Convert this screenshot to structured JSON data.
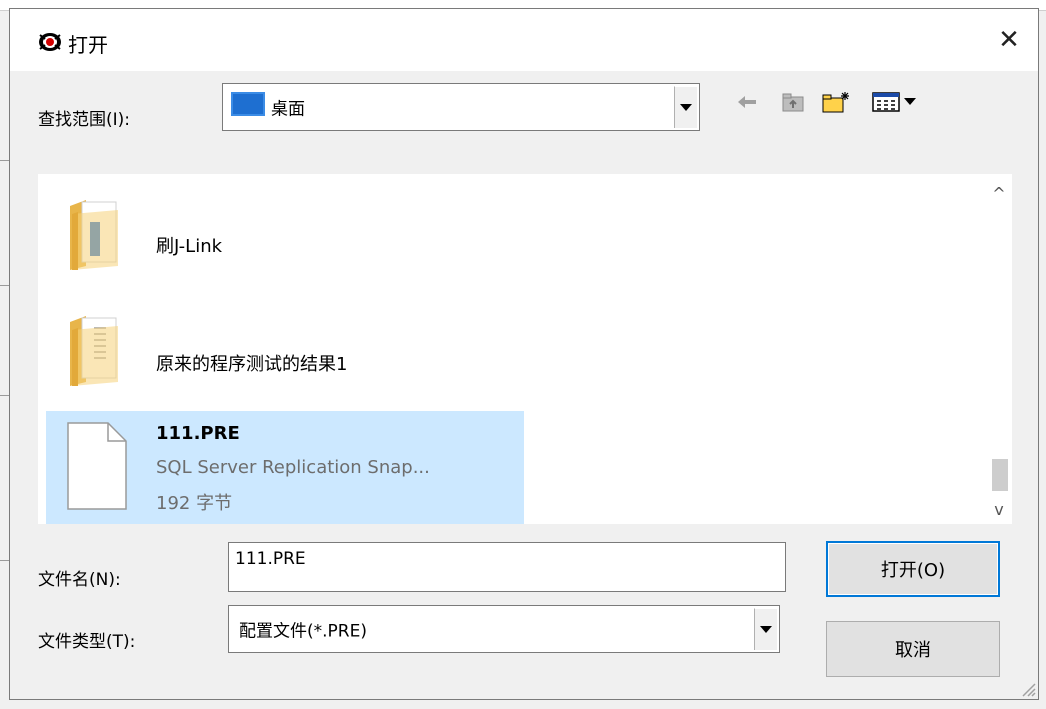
{
  "dialog": {
    "title": "打开",
    "close_symbol": "✕",
    "app_icon": "app-logo-icon"
  },
  "lookin": {
    "label": "查找范围(I):",
    "value": "桌面",
    "location_icon": "desktop-icon"
  },
  "toolbar": {
    "back_icon": "back-arrow-icon",
    "up_icon": "up-folder-icon",
    "new_folder_icon": "new-folder-icon",
    "view_icon": "view-menu-icon"
  },
  "files": [
    {
      "name": "刷J-Link",
      "type": "folder"
    },
    {
      "name": "原来的程序测试的结果1",
      "type": "folder"
    },
    {
      "name": "111.PRE",
      "description": "SQL Server Replication Snap...",
      "size": "192 字节",
      "type": "file",
      "selected": true
    }
  ],
  "scrollbar": {
    "up": "^",
    "down": "v"
  },
  "filename": {
    "label": "文件名(N):",
    "value": "111.PRE"
  },
  "filetype": {
    "label": "文件类型(T):",
    "value": "配置文件(*.PRE)"
  },
  "buttons": {
    "open": "打开(O)",
    "cancel": "取消"
  },
  "colors": {
    "selection": "#cce8ff",
    "default_button_border": "#0078d7"
  }
}
